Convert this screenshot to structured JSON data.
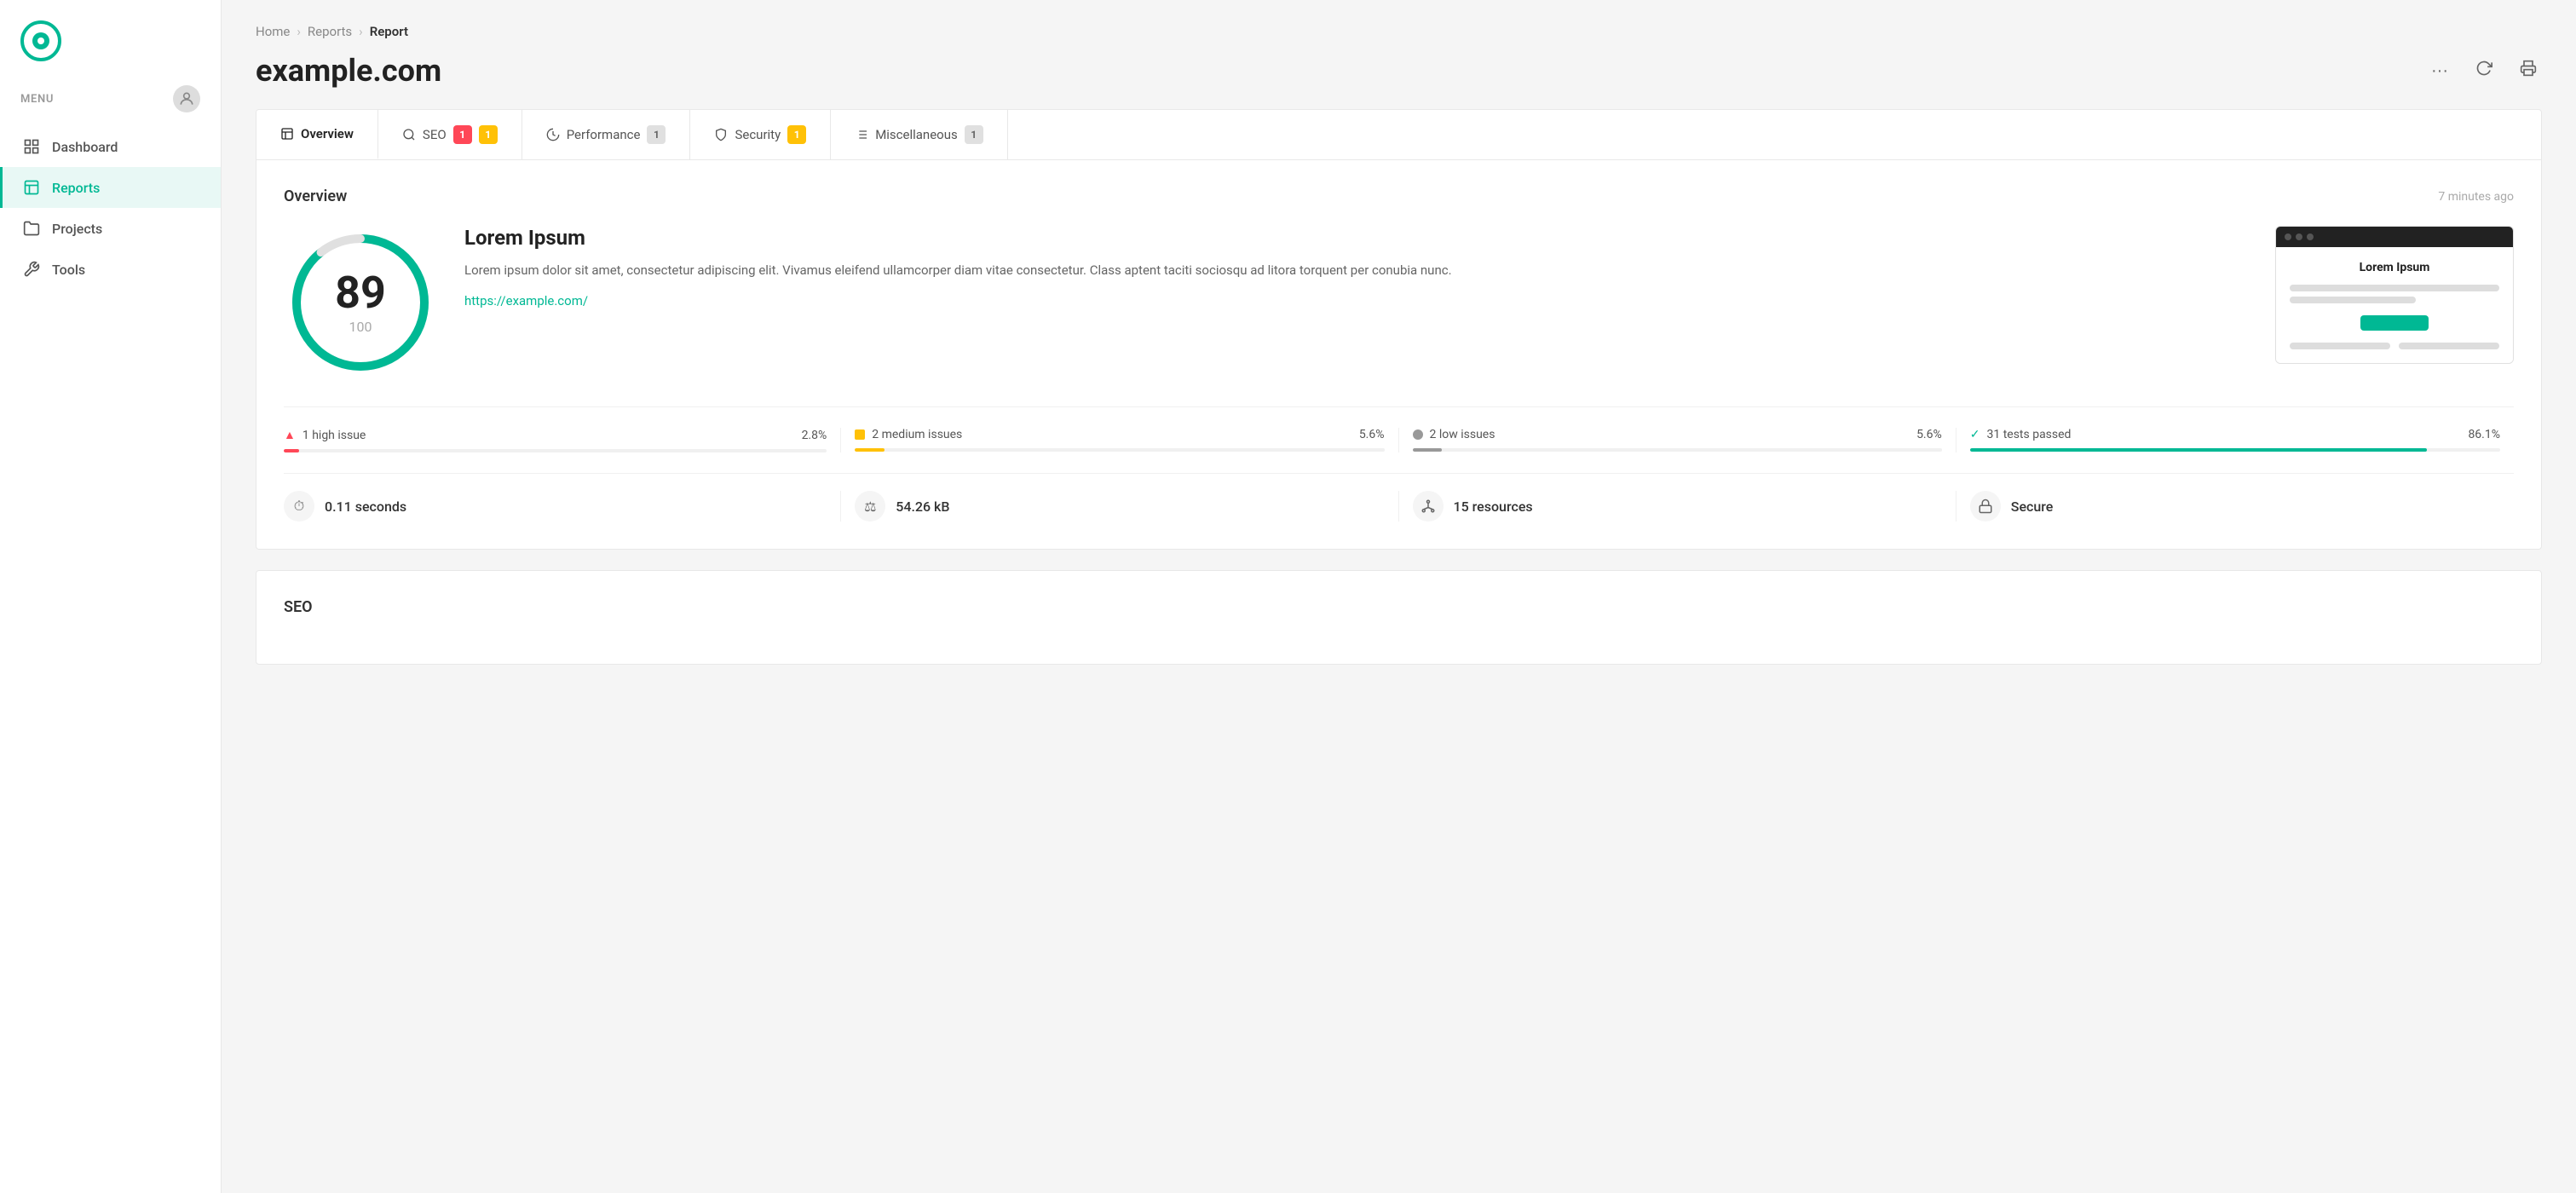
{
  "sidebar": {
    "menu_label": "MENU",
    "nav_items": [
      {
        "id": "dashboard",
        "label": "Dashboard",
        "active": false
      },
      {
        "id": "reports",
        "label": "Reports",
        "active": true
      },
      {
        "id": "projects",
        "label": "Projects",
        "active": false
      },
      {
        "id": "tools",
        "label": "Tools",
        "active": false
      }
    ]
  },
  "breadcrumb": {
    "home": "Home",
    "reports": "Reports",
    "current": "Report"
  },
  "page": {
    "title": "example.com"
  },
  "tabs": [
    {
      "id": "overview",
      "label": "Overview",
      "badge": null,
      "badge_type": null,
      "active": true
    },
    {
      "id": "seo",
      "label": "SEO",
      "badge": "1",
      "badge2": "1",
      "badge_type": "red-yellow",
      "active": false
    },
    {
      "id": "performance",
      "label": "Performance",
      "badge": "1",
      "badge_type": "gray",
      "active": false
    },
    {
      "id": "security",
      "label": "Security",
      "badge": "1",
      "badge_type": "yellow",
      "active": false
    },
    {
      "id": "miscellaneous",
      "label": "Miscellaneous",
      "badge": "1",
      "badge_type": "gray",
      "active": false
    }
  ],
  "overview": {
    "section_title": "Overview",
    "time_ago": "7 minutes ago",
    "score": {
      "value": 89,
      "max": 100,
      "percent": 89
    },
    "site": {
      "title": "Lorem Ipsum",
      "description": "Lorem ipsum dolor sit amet, consectetur adipiscing elit. Vivamus eleifend ullamcorper diam vitae consectetur. Class aptent taciti sociosqu ad litora torquent per conubia nunc.",
      "url": "https://example.com/"
    },
    "issues": [
      {
        "id": "high",
        "label": "1 high issue",
        "pct": "2.8%",
        "fill_pct": 2.8,
        "type": "red"
      },
      {
        "id": "medium",
        "label": "2 medium issues",
        "pct": "5.6%",
        "fill_pct": 5.6,
        "type": "yellow"
      },
      {
        "id": "low",
        "label": "2 low issues",
        "pct": "5.6%",
        "fill_pct": 5.6,
        "type": "gray"
      },
      {
        "id": "passed",
        "label": "31 tests passed",
        "pct": "86.1%",
        "fill_pct": 86.1,
        "type": "green"
      }
    ],
    "stats": [
      {
        "id": "time",
        "icon": "⏱",
        "value": "0.11 seconds"
      },
      {
        "id": "size",
        "icon": "⚖",
        "value": "54.26 kB"
      },
      {
        "id": "resources",
        "icon": "⚙",
        "value": "15 resources"
      },
      {
        "id": "secure",
        "icon": "🔒",
        "value": "Secure"
      }
    ]
  },
  "seo_section": {
    "title": "SEO"
  }
}
